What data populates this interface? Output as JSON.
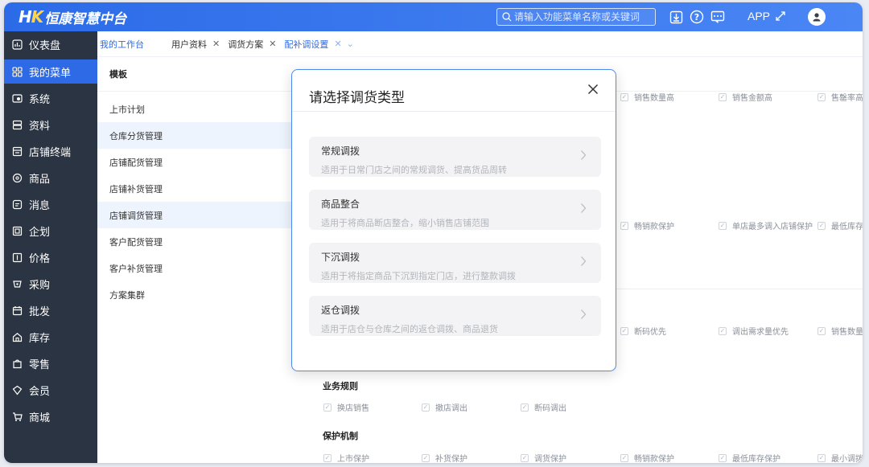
{
  "header": {
    "logo_mark": "H",
    "logo_mark_k": "K",
    "logo_text": "恒康智慧中台",
    "search_placeholder": "请输入功能菜单名称或关键词",
    "app_label": "APP"
  },
  "sidebar": {
    "items": [
      {
        "label": "仪表盘",
        "icon": "dashboard-icon"
      },
      {
        "label": "我的菜单",
        "icon": "grid-icon",
        "active": true
      },
      {
        "label": "系统",
        "icon": "system-icon"
      },
      {
        "label": "资料",
        "icon": "data-icon"
      },
      {
        "label": "店铺终端",
        "icon": "store-icon"
      },
      {
        "label": "商品",
        "icon": "goods-icon"
      },
      {
        "label": "消息",
        "icon": "message-icon"
      },
      {
        "label": "企划",
        "icon": "plan-icon"
      },
      {
        "label": "价格",
        "icon": "price-icon"
      },
      {
        "label": "采购",
        "icon": "purchase-icon"
      },
      {
        "label": "批发",
        "icon": "wholesale-icon"
      },
      {
        "label": "库存",
        "icon": "stock-icon"
      },
      {
        "label": "零售",
        "icon": "retail-icon"
      },
      {
        "label": "会员",
        "icon": "member-icon"
      },
      {
        "label": "商城",
        "icon": "mall-icon"
      }
    ]
  },
  "tabs": {
    "home": "我的工作台",
    "items": [
      {
        "label": "用户资料"
      },
      {
        "label": "调货方案"
      },
      {
        "label": "配补调设置",
        "active": true
      }
    ]
  },
  "templates": {
    "header": "模板",
    "items": [
      {
        "label": "上市计划"
      },
      {
        "label": "仓库分货管理",
        "highlighted": true
      },
      {
        "label": "店铺配货管理"
      },
      {
        "label": "店铺补货管理"
      },
      {
        "label": "店铺调货管理",
        "highlighted": true
      },
      {
        "label": "客户配货管理"
      },
      {
        "label": "客户补货管理"
      },
      {
        "label": "方案集群"
      }
    ]
  },
  "rules": {
    "row1": [
      "销售数量高",
      "销售金额高",
      "售罄率高"
    ],
    "row2": [
      "畅销款保护",
      "单店最多调入店铺保护",
      "最低库存"
    ],
    "row3": [
      "断码优先",
      "调出需求量优先",
      "销售数量"
    ],
    "business_title": "业务规则",
    "business": [
      "换店销售",
      "撤店调出",
      "断码调出"
    ],
    "protect_title": "保护机制",
    "protect": [
      "上市保护",
      "补货保护",
      "调货保护",
      "畅销款保护",
      "最低库存保护",
      "最小调拨"
    ]
  },
  "modal": {
    "title": "请选择调货类型",
    "options": [
      {
        "title": "常规调拨",
        "desc": "适用于日常门店之间的常规调货、提高货品周转"
      },
      {
        "title": "商品整合",
        "desc": "适用于将商品断店整合，缩小销售店铺范围"
      },
      {
        "title": "下沉调拨",
        "desc": "适用于将指定商品下沉到指定门店，进行整款调拨"
      },
      {
        "title": "返仓调拨",
        "desc": "适用于店仓与仓库之间的返仓调拨、商品退货"
      }
    ]
  },
  "colors": {
    "primary": "#2f6ae6",
    "sidebar_bg": "#2b3442",
    "logo_accent": "#ffd34a"
  }
}
